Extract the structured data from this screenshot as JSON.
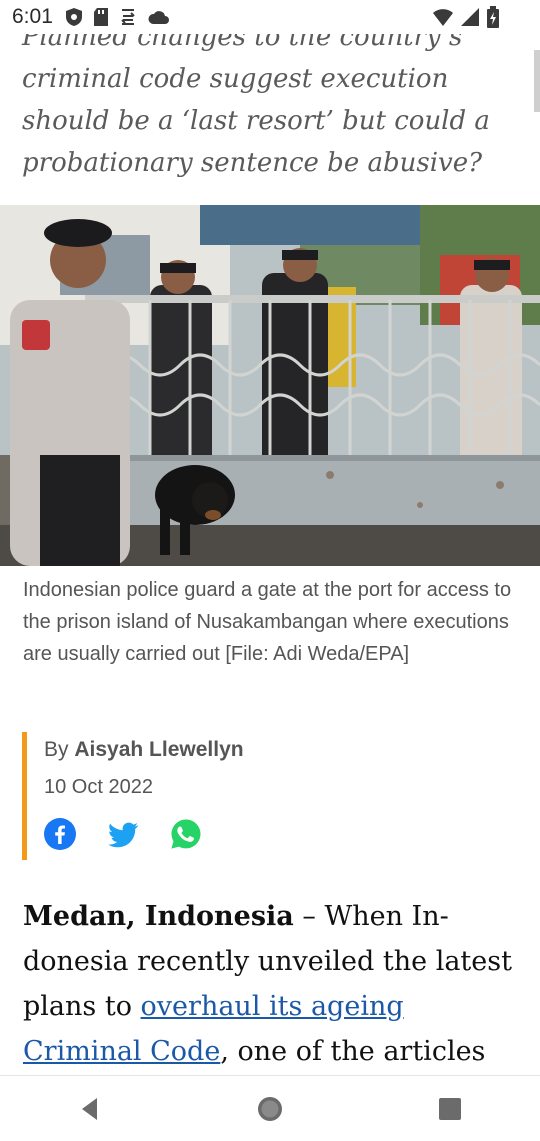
{
  "status_bar": {
    "time": "6:01",
    "icons_left": [
      "shield-icon",
      "sd-card-icon",
      "sync-icon",
      "cloud-icon"
    ],
    "icons_right": [
      "wifi-icon",
      "signal-icon",
      "battery-icon"
    ]
  },
  "article": {
    "standfirst_lines": [
      "Planned changes to the country’s",
      "criminal code suggest execution",
      "should be a ‘last resort’ but could a",
      "probationary sentence be abusive?"
    ],
    "hero_image_alt": "police-guard-gate-photo",
    "caption": "Indonesian police guard a gate at the port for access to the prison island of Nusakambangan where executions are usually carried out [File: Adi Weda/EPA]",
    "byline_prefix": "By",
    "author": "Aisyah Llewellyn",
    "date": "10 Oct 2022",
    "share": [
      "facebook-icon",
      "twitter-icon",
      "whatsapp-icon"
    ],
    "body": {
      "lead": "Medan, Indonesia",
      "text_1": " – When In-donesia recently unveiled the latest plans to ",
      "link": "overhaul its ageing Criminal Code",
      "text_2": ", one of the articles"
    }
  },
  "colors": {
    "accent_bar": "#f39a1b",
    "link": "#1b58a8",
    "facebook": "#1877f2",
    "twitter": "#1da1f2",
    "whatsapp": "#25d366"
  },
  "nav_bar": [
    "back-icon",
    "home-icon",
    "recents-icon"
  ]
}
